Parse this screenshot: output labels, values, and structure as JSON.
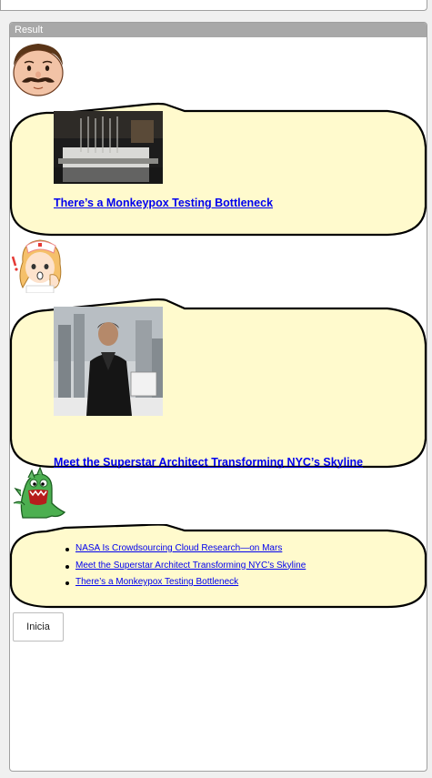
{
  "panel": {
    "header": "Result"
  },
  "avatars": [
    {
      "name": "mustache-man-avatar"
    },
    {
      "name": "nurse-avatar"
    },
    {
      "name": "green-dinosaur-avatar"
    }
  ],
  "messages": [
    {
      "headline": "There’s a Monkeypox Testing Bottleneck"
    },
    {
      "headline": "Meet the Superstar Architect Transforming NYC’s Skyline"
    }
  ],
  "list_message": {
    "items": [
      "NASA Is Crowdsourcing Cloud Research—on Mars",
      "Meet the Superstar Architect Transforming NYC’s Skyline",
      "There’s a Monkeypox Testing Bottleneck"
    ]
  },
  "button": {
    "label": "Inicia"
  },
  "colors": {
    "bubble_fill": "#fffacd",
    "link": "#0000ee",
    "header_bg": "#a8a8a8"
  }
}
